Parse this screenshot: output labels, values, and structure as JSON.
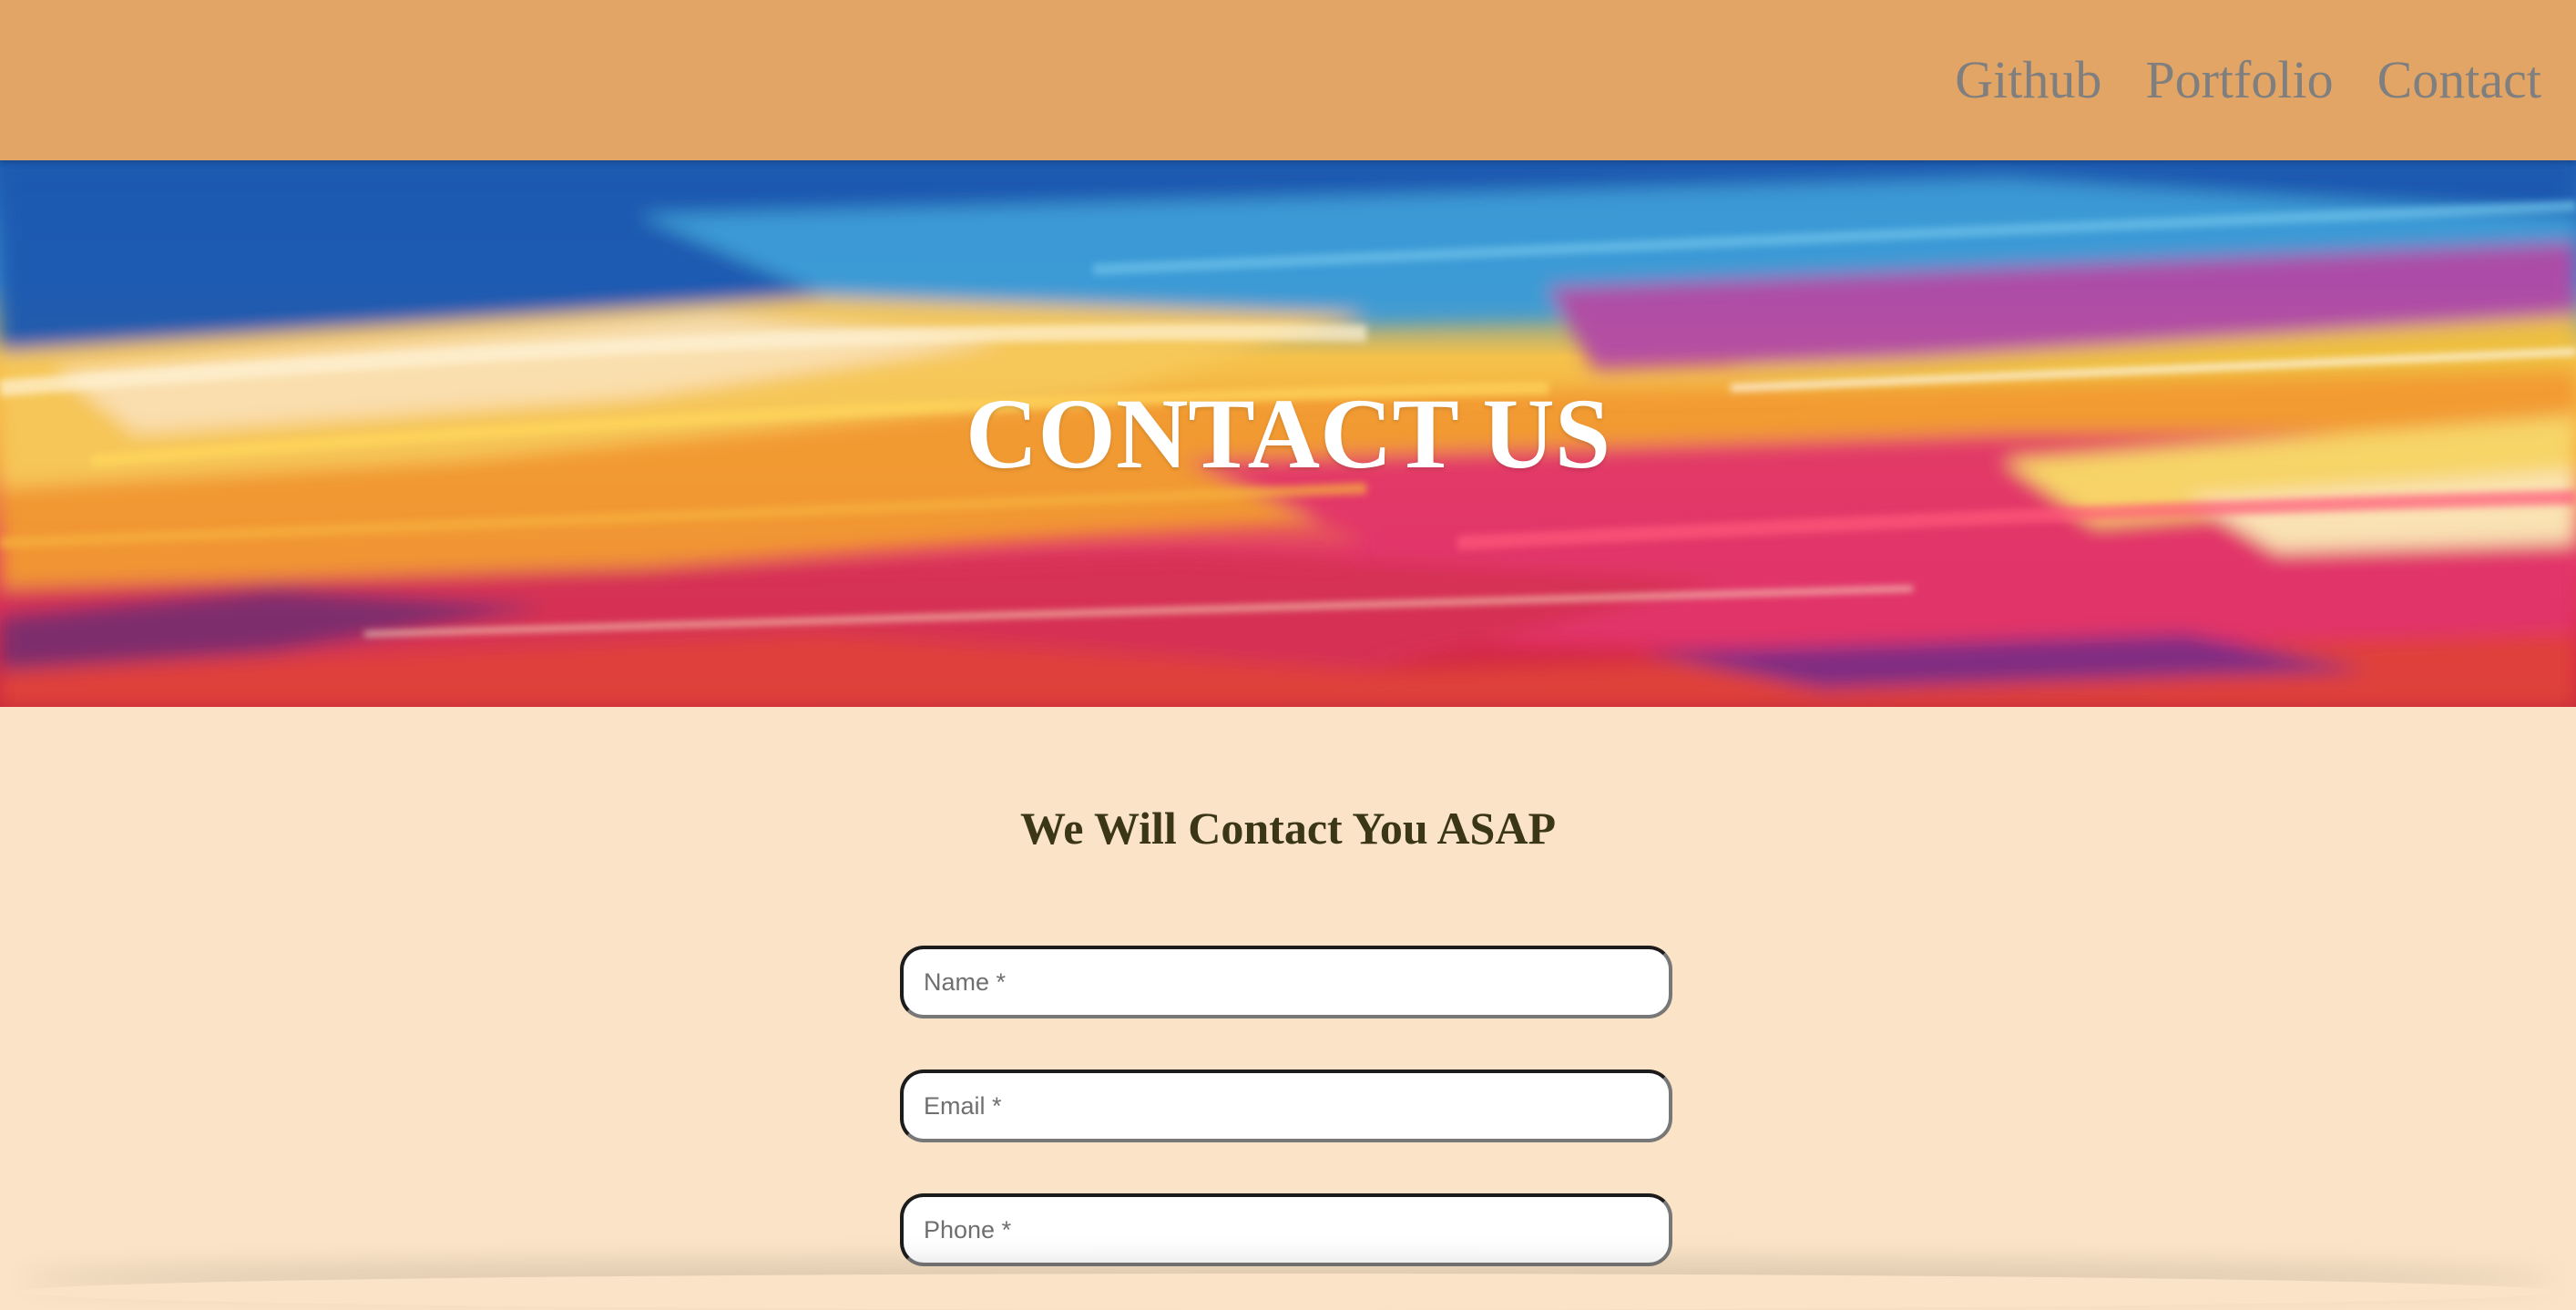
{
  "nav": {
    "links": [
      {
        "label": "Github"
      },
      {
        "label": "Portfolio"
      },
      {
        "label": "Contact"
      }
    ],
    "background": "#e2a565",
    "link_color": "#7f7f7f"
  },
  "hero": {
    "title": "CONTACT US",
    "image": "abstract-paint-strokes"
  },
  "content": {
    "heading": "We Will Contact You ASAP",
    "background": "#fae3c6"
  },
  "form": {
    "name_placeholder": "Name *",
    "email_placeholder": "Email *",
    "phone_placeholder": "Phone *"
  }
}
